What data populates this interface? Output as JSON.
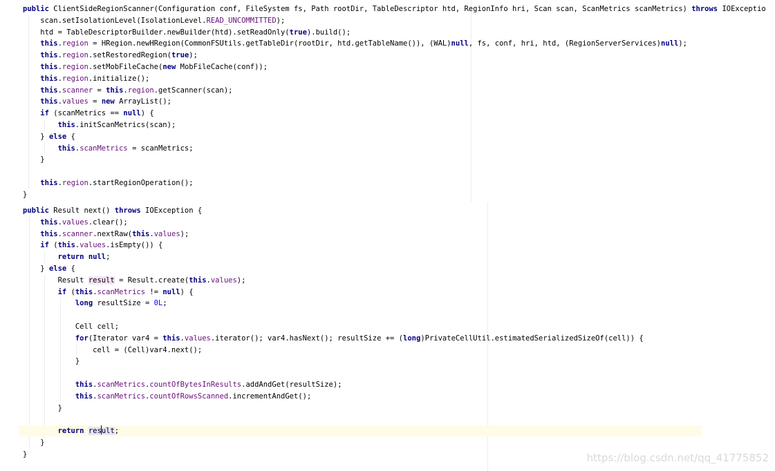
{
  "code_blocks": [
    {
      "name": "constructor-block",
      "lines": [
        [
          {
            "t": "public",
            "c": "kw"
          },
          {
            "t": " ClientSideRegionScanner(Configuration conf, FileSystem fs, Path rootDir, TableDescriptor htd, RegionInfo hri, Scan scan, ScanMetrics scanMetrics) "
          },
          {
            "t": "throws",
            "c": "kw"
          },
          {
            "t": " IOExceptio"
          }
        ],
        [
          {
            "t": "    scan.setIsolationLevel(IsolationLevel."
          },
          {
            "t": "READ_UNCOMMITTED",
            "c": "fld"
          },
          {
            "t": ");"
          }
        ],
        [
          {
            "t": "    htd = TableDescriptorBuilder.newBuilder(htd).setReadOnly("
          },
          {
            "t": "true",
            "c": "kw"
          },
          {
            "t": ").build();"
          }
        ],
        [
          {
            "t": "    "
          },
          {
            "t": "this",
            "c": "kw"
          },
          {
            "t": "."
          },
          {
            "t": "region",
            "c": "fld"
          },
          {
            "t": " = HRegion.newHRegion(CommonFSUtils.getTableDir(rootDir, htd.getTableName()), (WAL)"
          },
          {
            "t": "null",
            "c": "kw"
          },
          {
            "t": ", fs, conf, hri, htd, (RegionServerServices)"
          },
          {
            "t": "null",
            "c": "kw"
          },
          {
            "t": ");"
          }
        ],
        [
          {
            "t": "    "
          },
          {
            "t": "this",
            "c": "kw"
          },
          {
            "t": "."
          },
          {
            "t": "region",
            "c": "fld"
          },
          {
            "t": ".setRestoredRegion("
          },
          {
            "t": "true",
            "c": "kw"
          },
          {
            "t": ");"
          }
        ],
        [
          {
            "t": "    "
          },
          {
            "t": "this",
            "c": "kw"
          },
          {
            "t": "."
          },
          {
            "t": "region",
            "c": "fld"
          },
          {
            "t": ".setMobFileCache("
          },
          {
            "t": "new",
            "c": "kw"
          },
          {
            "t": " MobFileCache(conf));"
          }
        ],
        [
          {
            "t": "    "
          },
          {
            "t": "this",
            "c": "kw"
          },
          {
            "t": "."
          },
          {
            "t": "region",
            "c": "fld"
          },
          {
            "t": ".initialize();"
          }
        ],
        [
          {
            "t": "    "
          },
          {
            "t": "this",
            "c": "kw"
          },
          {
            "t": "."
          },
          {
            "t": "scanner",
            "c": "fld"
          },
          {
            "t": " = "
          },
          {
            "t": "this",
            "c": "kw"
          },
          {
            "t": "."
          },
          {
            "t": "region",
            "c": "fld"
          },
          {
            "t": ".getScanner(scan);"
          }
        ],
        [
          {
            "t": "    "
          },
          {
            "t": "this",
            "c": "kw"
          },
          {
            "t": "."
          },
          {
            "t": "values",
            "c": "fld"
          },
          {
            "t": " = "
          },
          {
            "t": "new",
            "c": "kw"
          },
          {
            "t": " ArrayList();"
          }
        ],
        [
          {
            "t": "    "
          },
          {
            "t": "if",
            "c": "kw"
          },
          {
            "t": " (scanMetrics == "
          },
          {
            "t": "null",
            "c": "kw"
          },
          {
            "t": ") {"
          }
        ],
        [
          {
            "t": "        "
          },
          {
            "t": "this",
            "c": "kw"
          },
          {
            "t": ".initScanMetrics(scan);"
          }
        ],
        [
          {
            "t": "    } "
          },
          {
            "t": "else",
            "c": "kw"
          },
          {
            "t": " {"
          }
        ],
        [
          {
            "t": "        "
          },
          {
            "t": "this",
            "c": "kw"
          },
          {
            "t": "."
          },
          {
            "t": "scanMetrics",
            "c": "fld"
          },
          {
            "t": " = scanMetrics;"
          }
        ],
        [
          {
            "t": "    }"
          }
        ],
        [],
        [
          {
            "t": "    "
          },
          {
            "t": "this",
            "c": "kw"
          },
          {
            "t": "."
          },
          {
            "t": "region",
            "c": "fld"
          },
          {
            "t": ".startRegionOperation();"
          }
        ],
        [
          {
            "t": "}"
          }
        ]
      ]
    },
    {
      "name": "next-method-block",
      "lines": [
        [
          {
            "t": "public",
            "c": "kw"
          },
          {
            "t": " Result next() "
          },
          {
            "t": "throws",
            "c": "kw"
          },
          {
            "t": " IOException {"
          }
        ],
        [
          {
            "t": "    "
          },
          {
            "t": "this",
            "c": "kw"
          },
          {
            "t": "."
          },
          {
            "t": "values",
            "c": "fld"
          },
          {
            "t": ".clear();"
          }
        ],
        [
          {
            "t": "    "
          },
          {
            "t": "this",
            "c": "kw"
          },
          {
            "t": "."
          },
          {
            "t": "scanner",
            "c": "fld"
          },
          {
            "t": ".nextRaw("
          },
          {
            "t": "this",
            "c": "kw"
          },
          {
            "t": "."
          },
          {
            "t": "values",
            "c": "fld"
          },
          {
            "t": ");"
          }
        ],
        [
          {
            "t": "    "
          },
          {
            "t": "if",
            "c": "kw"
          },
          {
            "t": " ("
          },
          {
            "t": "this",
            "c": "kw"
          },
          {
            "t": "."
          },
          {
            "t": "values",
            "c": "fld"
          },
          {
            "t": ".isEmpty()) {"
          }
        ],
        [
          {
            "t": "        "
          },
          {
            "t": "return null",
            "c": "kw"
          },
          {
            "t": ";"
          }
        ],
        [
          {
            "t": "    } "
          },
          {
            "t": "else",
            "c": "kw"
          },
          {
            "t": " {"
          }
        ],
        [
          {
            "t": "        Result "
          },
          {
            "t": "result",
            "c": "hl-write"
          },
          {
            "t": " = Result.create("
          },
          {
            "t": "this",
            "c": "kw"
          },
          {
            "t": "."
          },
          {
            "t": "values",
            "c": "fld"
          },
          {
            "t": ");"
          }
        ],
        [
          {
            "t": "        "
          },
          {
            "t": "if",
            "c": "kw"
          },
          {
            "t": " ("
          },
          {
            "t": "this",
            "c": "kw"
          },
          {
            "t": "."
          },
          {
            "t": "scanMetrics",
            "c": "fld"
          },
          {
            "t": " != "
          },
          {
            "t": "null",
            "c": "kw"
          },
          {
            "t": ") {"
          }
        ],
        [
          {
            "t": "            "
          },
          {
            "t": "long",
            "c": "kw"
          },
          {
            "t": " resultSize = "
          },
          {
            "t": "0L",
            "c": "num"
          },
          {
            "t": ";"
          }
        ],
        [],
        [
          {
            "t": "            Cell cell;"
          }
        ],
        [
          {
            "t": "            "
          },
          {
            "t": "for",
            "c": "kw"
          },
          {
            "t": "(Iterator var4 = "
          },
          {
            "t": "this",
            "c": "kw"
          },
          {
            "t": "."
          },
          {
            "t": "values",
            "c": "fld"
          },
          {
            "t": ".iterator(); var4.hasNext(); resultSize += ("
          },
          {
            "t": "long",
            "c": "kw"
          },
          {
            "t": ")PrivateCellUtil.estimatedSerializedSizeOf(cell)) {"
          }
        ],
        [
          {
            "t": "                cell = (Cell)var4.next();"
          }
        ],
        [
          {
            "t": "            }"
          }
        ],
        [],
        [
          {
            "t": "            "
          },
          {
            "t": "this",
            "c": "kw"
          },
          {
            "t": "."
          },
          {
            "t": "scanMetrics",
            "c": "fld"
          },
          {
            "t": "."
          },
          {
            "t": "countOfBytesInResults",
            "c": "fld"
          },
          {
            "t": ".addAndGet(resultSize);"
          }
        ],
        [
          {
            "t": "            "
          },
          {
            "t": "this",
            "c": "kw"
          },
          {
            "t": "."
          },
          {
            "t": "scanMetrics",
            "c": "fld"
          },
          {
            "t": "."
          },
          {
            "t": "countOfRowsScanned",
            "c": "fld"
          },
          {
            "t": ".incrementAndGet();"
          }
        ],
        [
          {
            "t": "        }"
          }
        ],
        [],
        [
          {
            "t": "        "
          },
          {
            "t": "return",
            "c": "kw"
          },
          {
            "t": " "
          },
          {
            "t": "result",
            "c": "hl-read",
            "caret": 3
          },
          {
            "t": ";"
          }
        ],
        [
          {
            "t": "    }"
          }
        ],
        [
          {
            "t": "}"
          }
        ]
      ]
    }
  ],
  "watermark": "https://blog.csdn.net/qq_41775852"
}
